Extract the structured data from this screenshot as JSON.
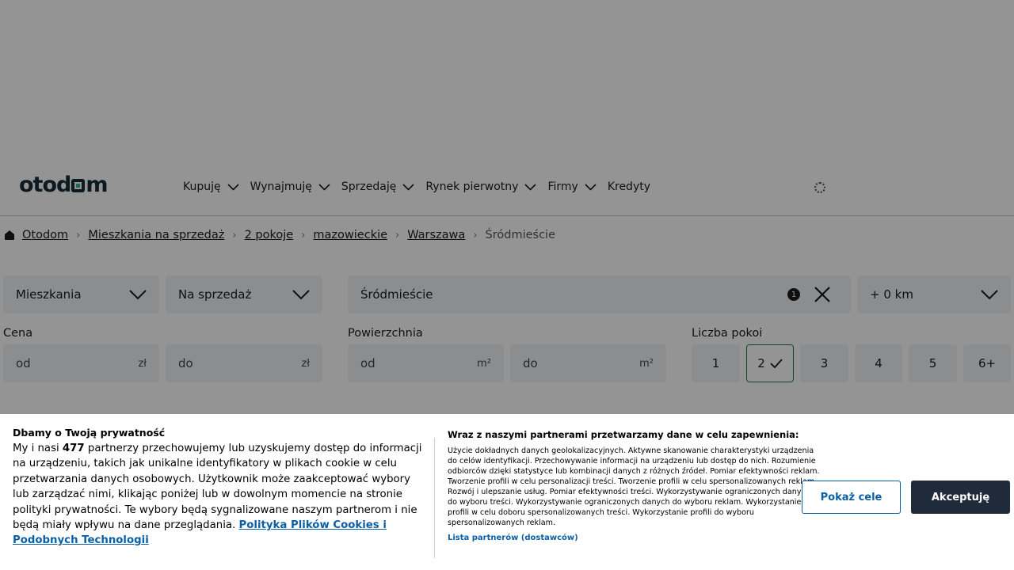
{
  "header": {
    "logo_text_left": "otod",
    "logo_text_right": "m",
    "nav": [
      {
        "label": "Kupuję",
        "has_dropdown": true
      },
      {
        "label": "Wynajmuję",
        "has_dropdown": true
      },
      {
        "label": "Sprzedaję",
        "has_dropdown": true
      },
      {
        "label": "Rynek pierwotny",
        "has_dropdown": true
      },
      {
        "label": "Firmy",
        "has_dropdown": true
      },
      {
        "label": "Kredyty",
        "has_dropdown": false
      }
    ]
  },
  "breadcrumb": {
    "items": [
      "Otodom",
      "Mieszkania na sprzedaż",
      "2 pokoje",
      "mazowieckie",
      "Warszawa"
    ],
    "current": "Śródmieście"
  },
  "filters": {
    "property_type": "Mieszkania",
    "transaction": "Na sprzedaż",
    "location": "Śródmieście",
    "location_count": "1",
    "distance": "+ 0 km",
    "price": {
      "label": "Cena",
      "from_placeholder": "od",
      "to_placeholder": "do",
      "unit": "zł"
    },
    "area": {
      "label": "Powierzchnia",
      "from_placeholder": "od",
      "to_placeholder": "do",
      "unit": "m²"
    },
    "rooms": {
      "label": "Liczba pokoi",
      "options": [
        "1",
        "2",
        "3",
        "4",
        "5",
        "6+"
      ],
      "selected": "2"
    }
  },
  "cookie_banner": {
    "title": "Dbamy o Twoją prywatność",
    "text_before_count": "My i nasi ",
    "partner_count": "477",
    "text_after_count": " partnerzy przechowujemy lub uzyskujemy dostęp do informacji na urządzeniu, takich jak unikalne identyfikatory w plikach cookie w celu przetwarzania danych osobowych. Użytkownik może zaakceptować wybory lub zarządzać nimi, klikając poniżej lub w dowolnym momencie na stronie polityki prywatności. Te wybory będą sygnalizowane naszym partnerom i nie będą miały wpływu na dane przeglądania. ",
    "policy_link": "Polityka Plików Cookies i Podobnych Technologii",
    "right_title": "Wraz z naszymi partnerami przetwarzamy dane w celu zapewnienia:",
    "purposes": "Użycie dokładnych danych geolokalizacyjnych. Aktywne skanowanie charakterystyki urządzenia do celów identyfikacji. Przechowywanie informacji na urządzeniu lub dostęp do nich. Rozumienie odbiorców dzięki statystyce lub kombinacji danych z różnych źródeł. Pomiar efektywności reklam. Tworzenie profili w celu personalizacji treści. Tworzenie profili w celu spersonalizowanych reklam. Rozwój i ulepszanie usług. Pomiar efektywności treści. Wykorzystywanie ograniczonych danych do wyboru treści. Wykorzystywanie ograniczonych danych do wyboru reklam. Wykorzystanie profili w celu doboru spersonalizowanych treści. Wykorzystanie profili do wyboru spersonalizowanych reklam.",
    "partners_link": "Lista partnerów (dostawców)",
    "show_purposes_button": "Pokaż cele",
    "accept_button": "Akceptuję"
  }
}
